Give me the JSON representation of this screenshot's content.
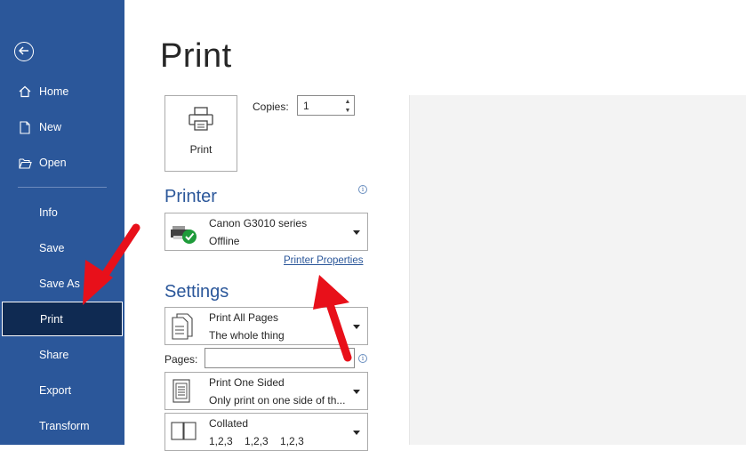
{
  "sidebar": {
    "back_icon": "back-arrow-icon",
    "items": [
      {
        "label": "Home",
        "icon": "home-icon"
      },
      {
        "label": "New",
        "icon": "new-document-icon"
      },
      {
        "label": "Open",
        "icon": "folder-open-icon"
      },
      {
        "label": "Info"
      },
      {
        "label": "Save"
      },
      {
        "label": "Save As"
      },
      {
        "label": "Print",
        "active": true
      },
      {
        "label": "Share"
      },
      {
        "label": "Export"
      },
      {
        "label": "Transform"
      }
    ],
    "bg_color": "#2b579a",
    "active_color": "#0f2a52"
  },
  "main": {
    "title": "Print",
    "print_button_label": "Print",
    "copies_label": "Copies:",
    "copies_value": "1",
    "printer_heading": "Printer",
    "printer": {
      "name": "Canon G3010 series",
      "status": "Offline"
    },
    "printer_properties_link": "Printer Properties",
    "settings_heading": "Settings",
    "settings": [
      {
        "line1": "Print All Pages",
        "line2": "The whole thing"
      },
      {
        "line1": "Print One Sided",
        "line2": "Only print on one side of th..."
      },
      {
        "line1": "Collated",
        "line2": "1,2,3    1,2,3    1,2,3"
      }
    ],
    "pages_label": "Pages:",
    "pages_value": "",
    "accent_color": "#2b579a"
  },
  "annotations": {
    "arrow_color": "#e8101a"
  }
}
